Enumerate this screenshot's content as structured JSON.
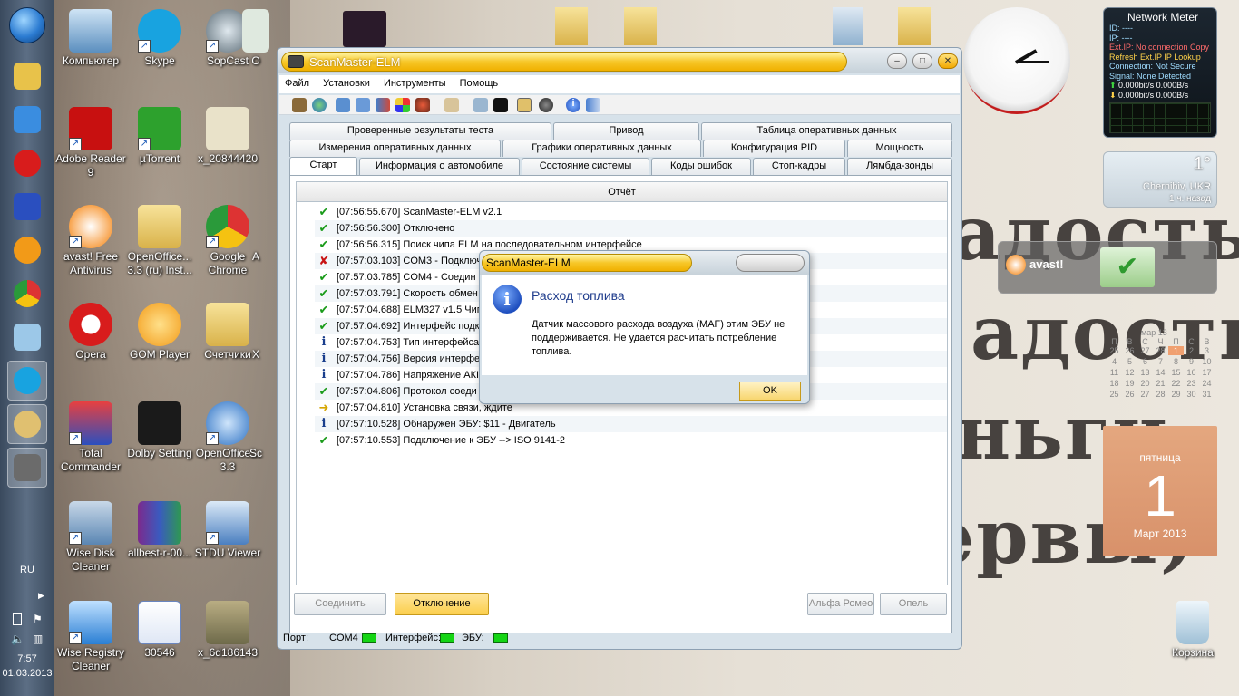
{
  "taskbar": {
    "language": "RU",
    "time": "7:57",
    "date": "01.03.2013"
  },
  "desktop_icons": [
    {
      "label": "Компьютер",
      "icon": "computer-icon"
    },
    {
      "label": "Skype",
      "icon": "skype-icon"
    },
    {
      "label": "SopCast",
      "icon": "sopcast-icon"
    },
    {
      "label": "O",
      "icon": "office-icon"
    },
    {
      "label": "Adobe Reader 9",
      "icon": "adobe-reader-icon"
    },
    {
      "label": "µTorrent",
      "icon": "utorrent-icon"
    },
    {
      "label": "x_20844420",
      "icon": "image-file-icon"
    },
    {
      "label": "avast! Free Antivirus",
      "icon": "avast-icon"
    },
    {
      "label": "OpenOffice... 3.3 (ru) Inst...",
      "icon": "folder-icon"
    },
    {
      "label": "Google Chrome",
      "icon": "chrome-icon"
    },
    {
      "label": "A",
      "icon": "app-icon"
    },
    {
      "label": "Opera",
      "icon": "opera-icon"
    },
    {
      "label": "GOM Player",
      "icon": "gom-player-icon"
    },
    {
      "label": "Счетчики",
      "icon": "folder-icon"
    },
    {
      "label": "X",
      "icon": "app-icon"
    },
    {
      "label": "Total Commander",
      "icon": "floppy-icon"
    },
    {
      "label": "Dolby Setting",
      "icon": "dolby-icon"
    },
    {
      "label": "OpenOffice... 3.3",
      "icon": "openoffice-icon"
    },
    {
      "label": "Sc",
      "icon": "app-icon"
    },
    {
      "label": "Wise Disk Cleaner",
      "icon": "wise-disk-icon"
    },
    {
      "label": "allbest-r-00...",
      "icon": "winrar-icon"
    },
    {
      "label": "STDU Viewer",
      "icon": "stdu-viewer-icon"
    },
    {
      "label": "Wise Registry Cleaner",
      "icon": "wise-registry-icon"
    },
    {
      "label": "30546",
      "icon": "word-doc-icon"
    },
    {
      "label": "x_6d186143",
      "icon": "image-file-icon"
    },
    {
      "label": "Корзина",
      "icon": "recycle-bin-icon"
    }
  ],
  "gadgets": {
    "network_meter": {
      "title": "Network Meter",
      "lines": [
        "ID: ----",
        "IP: ----",
        "Ext.IP: No connection Copy",
        "Refresh Ext.IP      IP Lookup",
        "Connection: Not Secure",
        "Signal:  None Detected"
      ],
      "down": "0.000bit/s     0.000B/s",
      "up": "0.000bit/s     0.000B/s"
    },
    "weather": {
      "temp": "1°",
      "city": "Chernihiv, UKR",
      "ago": "1 ч. назад"
    },
    "avast": {
      "label": "avast!"
    },
    "calendar": {
      "month": "мар 13",
      "weekdays": [
        "П",
        "В",
        "С",
        "Ч",
        "П",
        "С",
        "В"
      ],
      "days": [
        "25",
        "26",
        "27",
        "28",
        "1",
        "2",
        "3",
        "4",
        "5",
        "6",
        "7",
        "8",
        "9",
        "10",
        "11",
        "12",
        "13",
        "14",
        "15",
        "16",
        "17",
        "18",
        "19",
        "20",
        "21",
        "22",
        "23",
        "24",
        "25",
        "26",
        "27",
        "28",
        "29",
        "30",
        "31"
      ]
    },
    "datecard": {
      "weekday": "пятница",
      "day": "1",
      "monthyear": "Март 2013"
    },
    "wallpaper_text": [
      "адость,",
      "адость,",
      "еньги,",
      "нервы)"
    ]
  },
  "app": {
    "title": "ScanMaster-ELM",
    "menu": [
      "Файл",
      "Установки",
      "Инструменты",
      "Помощь"
    ],
    "tabs_row1": [
      "Проверенные результаты теста",
      "Привод",
      "Таблица оперативных данных"
    ],
    "tabs_row2": [
      "Измерения оперативных данных",
      "Графики оперативных данных",
      "Конфигурация PID",
      "Мощность"
    ],
    "tabs_row3": [
      "Старт",
      "Информация о автомобиле",
      "Состояние системы",
      "Коды ошибок",
      "Стоп-кадры",
      "Лямбда-зонды"
    ],
    "report_header": "Отчёт",
    "log": [
      {
        "icon": "check",
        "text": "[07:56:55.670] ScanMaster-ELM v2.1"
      },
      {
        "icon": "check",
        "text": "[07:56:56.300] Отключено"
      },
      {
        "icon": "check",
        "text": "[07:56:56.315] Поиск чипа ELM на последовательном интерфейсе"
      },
      {
        "icon": "cross",
        "text": "[07:57:03.103] COM3 - Подключ"
      },
      {
        "icon": "check",
        "text": "[07:57:03.785] COM4 - Соедин"
      },
      {
        "icon": "check",
        "text": "[07:57:03.791] Скорость обмен"
      },
      {
        "icon": "check",
        "text": "[07:57:04.688] ELM327 v1.5 Чип"
      },
      {
        "icon": "check",
        "text": "[07:57:04.692] Интерфейс подк"
      },
      {
        "icon": "info",
        "text": "[07:57:04.753] Тип интерфейса"
      },
      {
        "icon": "info",
        "text": "[07:57:04.756] Версия интерфе"
      },
      {
        "icon": "info",
        "text": "[07:57:04.786] Напряжение АКІ"
      },
      {
        "icon": "check",
        "text": "[07:57:04.806] Протокол соеди"
      },
      {
        "icon": "arrow",
        "text": "[07:57:04.810] Установка связи, ждите"
      },
      {
        "icon": "info",
        "text": "[07:57:10.528] Обнаружен ЭБУ: $11 - Двигатель"
      },
      {
        "icon": "check",
        "text": "[07:57:10.553] Подключение к ЭБУ --> ISO 9141-2"
      }
    ],
    "buttons": {
      "connect": "Соединить",
      "disconnect": "Отключение",
      "alfa": "Альфа Ромео",
      "opel": "Опель"
    },
    "status": {
      "port_label": "Порт:",
      "port_value": "COM4",
      "interface_label": "Интерфейс:",
      "ecu_label": "ЭБУ:"
    }
  },
  "dialog": {
    "title": "ScanMaster-ELM",
    "heading": "Расход топлива",
    "message": "Датчик массового расхода воздуха (MAF) этим ЭБУ не поддерживается. Не удается расчитать потребление топлива.",
    "ok": "OK"
  }
}
